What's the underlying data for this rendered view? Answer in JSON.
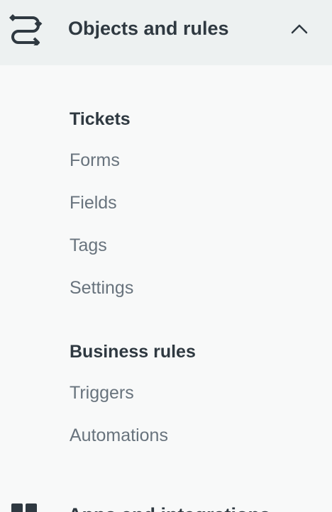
{
  "section": {
    "title": "Objects and rules",
    "icon": "objects-and-rules-icon",
    "expanded": true
  },
  "groups": [
    {
      "heading": "Tickets",
      "items": [
        "Forms",
        "Fields",
        "Tags",
        "Settings"
      ]
    },
    {
      "heading": "Business rules",
      "items": [
        "Triggers",
        "Automations"
      ]
    }
  ],
  "next_section": {
    "title": "Apps and integrations",
    "icon": "apps-grid-icon"
  },
  "colors": {
    "header_bg": "#edf1f1",
    "panel_bg": "#f8f9f9",
    "heading_text": "#2f3941",
    "link_text": "#68737d"
  }
}
